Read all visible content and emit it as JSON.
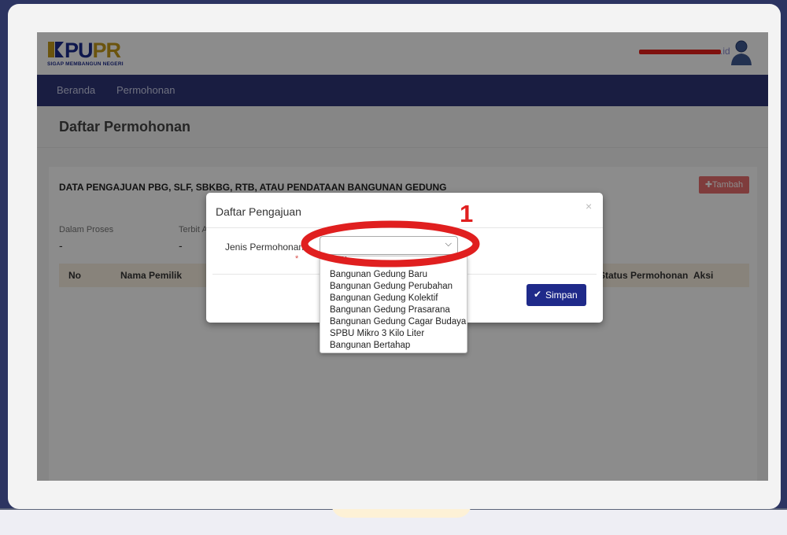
{
  "header": {
    "logo": {
      "text_main_1": "PU",
      "text_main_2": "PR",
      "tagline": "SIGAP MEMBANGUN NEGERI"
    },
    "user": {
      "email_suffix": ".id"
    }
  },
  "nav": {
    "items": [
      {
        "label": "Beranda"
      },
      {
        "label": "Permohonan"
      }
    ]
  },
  "page": {
    "title": "Daftar Permohonan"
  },
  "panel": {
    "title": "DATA PENGAJUAN PBG, SLF, SBKBG, RTB, ATAU PENDATAAN BANGUNAN GEDUNG",
    "add_button": "Tambah",
    "stats": [
      {
        "label": "Dalam Proses",
        "value": "-"
      },
      {
        "label": "Terbit A",
        "value": "-"
      }
    ],
    "columns": [
      "No",
      "Nama Pemilik",
      "Status Permohonan",
      "Aksi"
    ]
  },
  "modal": {
    "title": "Daftar Pengajuan",
    "close": "×",
    "field_label": "Jenis Permohonan",
    "required_mark": "*",
    "select_value": "",
    "save_button": "Simpan",
    "options": [
      "Bangunan Gedung Baru",
      "Bangunan Gedung Perubahan",
      "Bangunan Gedung Kolektif",
      "Bangunan Gedung Prasarana",
      "Bangunan Gedung Cagar Budaya",
      "SPBU Mikro 3 Kilo Liter",
      "Bangunan Bertahap"
    ]
  },
  "annotation": {
    "number": "1",
    "color": "#e01f1f"
  },
  "colors": {
    "navbar": "#2f3677",
    "primary_button": "#1f2a8a",
    "add_button": "#e86d6d",
    "table_header": "#f8efe0"
  }
}
